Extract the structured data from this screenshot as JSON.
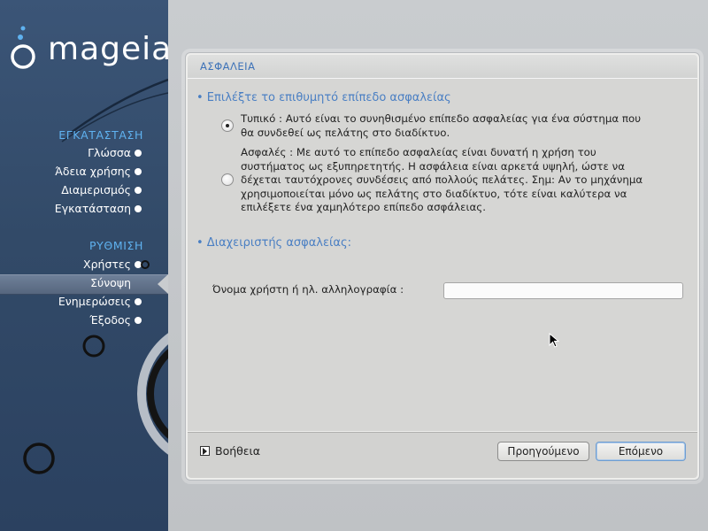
{
  "app": {
    "logo_text": "mageia"
  },
  "sidebar": {
    "sections": [
      {
        "title": "ΕΓΚΑΤΑΣΤΑΣΗ",
        "items": [
          {
            "label": "Γλώσσα",
            "state": "done"
          },
          {
            "label": "Άδεια χρήσης",
            "state": "done"
          },
          {
            "label": "Διαμερισμός",
            "state": "done"
          },
          {
            "label": "Εγκατάσταση",
            "state": "done"
          }
        ]
      },
      {
        "title": "ΡΥΘΜΙΣΗ",
        "items": [
          {
            "label": "Χρήστες",
            "state": "in-progress"
          },
          {
            "label": "Σύνοψη",
            "state": "current"
          },
          {
            "label": "Ενημερώσεις",
            "state": "pending"
          },
          {
            "label": "Έξοδος",
            "state": "pending"
          }
        ]
      }
    ]
  },
  "dialog": {
    "title": "ΑΣΦΑΛΕΙΑ",
    "security_level": {
      "title": "• Επιλέξτε το επιθυμητό επίπεδο ασφαλείας",
      "options": [
        {
          "lines": [
            "Τυπικό : Αυτό είναι το συνηθισμένο επίπεδο ασφαλείας για ένα σύστημα που",
            "θα συνδεθεί ως πελάτης στο διαδίκτυο."
          ],
          "selected": true
        },
        {
          "lines": [
            "Ασφαλές : Με αυτό το επίπεδο ασφαλείας είναι δυνατή η χρήση του",
            "συστήματος ως εξυπηρετητής. Η ασφάλεια είναι αρκετά υψηλή, ώστε να",
            "δέχεται ταυτόχρονες συνδέσεις από πολλούς πελάτες. Σημ: Αν το μηχάνημα",
            "χρησιμοποιείται μόνο ως πελάτης στο διαδίκτυο, τότε είναι καλύτερα να",
            "επιλέξετε ένα χαμηλότερο επίπεδο ασφάλειας."
          ],
          "selected": false
        }
      ]
    },
    "admin": {
      "title": "• Διαχειριστής ασφαλείας:",
      "user_label": "Όνομα χρήστη ή ηλ. αλληλογραφία :",
      "user_value": ""
    },
    "footer": {
      "help_label": "Βοήθεια",
      "prev_label": "Προηγούμενο",
      "next_label": "Επόμενο"
    }
  },
  "colors": {
    "sidebar_bg": "#324a68",
    "section_title": "#5fb2f0",
    "accent_text": "#4a7fc3"
  }
}
